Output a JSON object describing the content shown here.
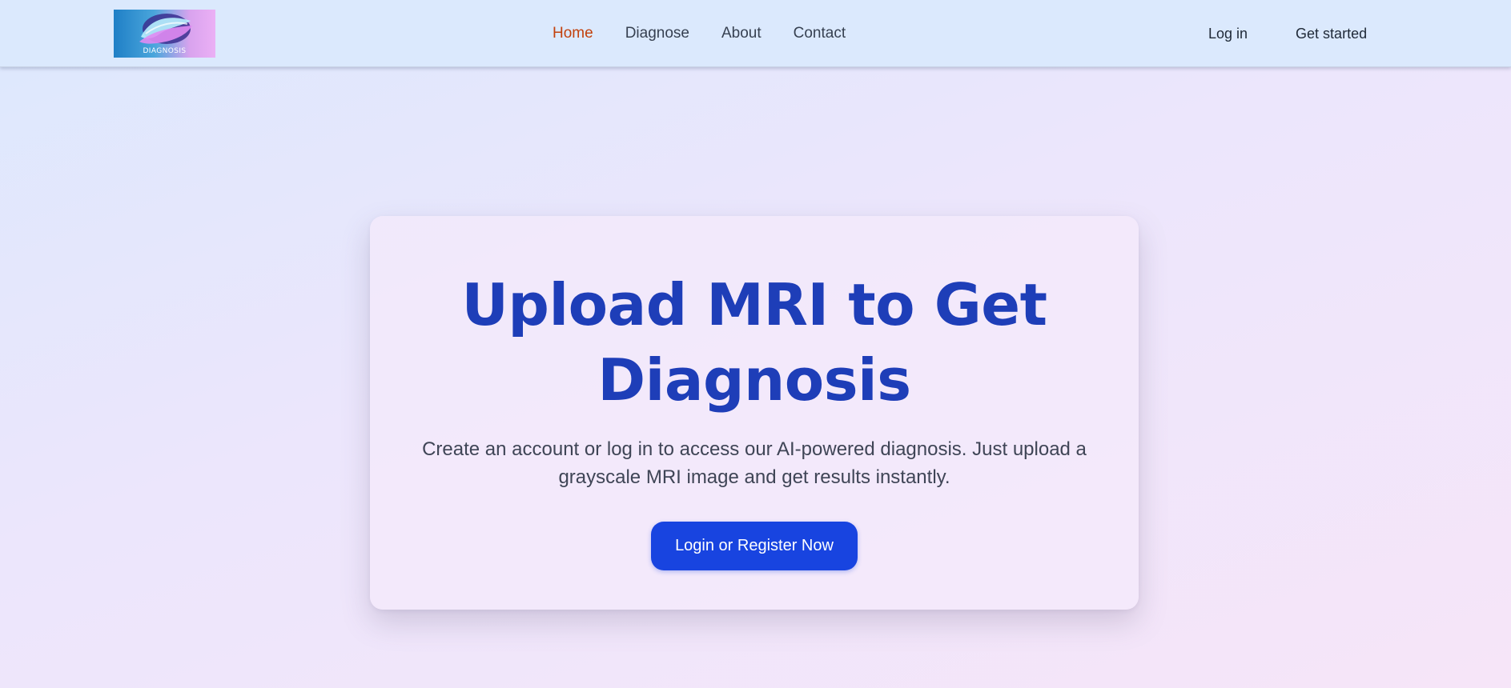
{
  "brand": {
    "logo_text": "DIAGNOSIS",
    "logo_icon": "swirl-wave-logo"
  },
  "nav": {
    "items": [
      {
        "label": "Home",
        "active": true
      },
      {
        "label": "Diagnose",
        "active": false
      },
      {
        "label": "About",
        "active": false
      },
      {
        "label": "Contact",
        "active": false
      }
    ],
    "active_color": "#c2410c"
  },
  "auth": {
    "login_label": "Log in",
    "signup_label": "Get started"
  },
  "hero": {
    "title": "Upload MRI to Get Diagnosis",
    "description": "Create an account or log in to access our AI-powered diagnosis. Just upload a grayscale MRI image and get results instantly.",
    "cta_label": "Login or Register Now"
  },
  "colors": {
    "title": "#1e3eb8",
    "button": "#1844e0",
    "navbar": "#dbe9fd"
  }
}
